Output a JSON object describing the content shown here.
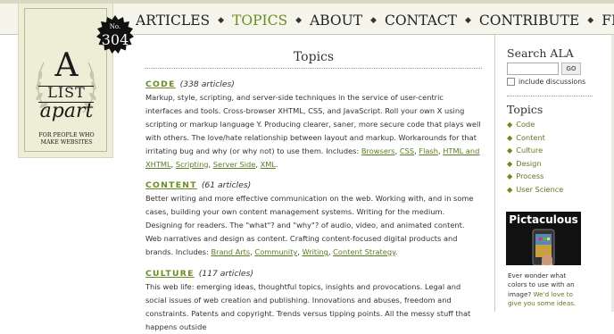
{
  "nav": {
    "items": [
      {
        "label": "ARTICLES",
        "active": false
      },
      {
        "label": "TOPICS",
        "active": true
      },
      {
        "label": "ABOUT",
        "active": false
      },
      {
        "label": "CONTACT",
        "active": false
      },
      {
        "label": "CONTRIBUTE",
        "active": false
      },
      {
        "label": "FEED",
        "active": false
      }
    ],
    "separator": "◆"
  },
  "logo": {
    "big_letter": "A",
    "list": "LIST",
    "apart": "apart",
    "tagline_1": "FOR PEOPLE WHO",
    "tagline_2": "MAKE WEBSITES"
  },
  "issue": {
    "no_label": "No.",
    "number": "304"
  },
  "main": {
    "title": "Topics",
    "sections": [
      {
        "name": "CODE",
        "count": "(338 articles)",
        "description": "Markup, style, scripting, and server-side techniques in the service of user-centric interfaces and tools. Cross-browser XHTML, CSS, and JavaScript. Roll your own X using scripting or markup language Y. Producing clearer, saner, more secure code that plays well with others. The love/hate relationship between layout and markup. Workarounds for that irritating bug and why (or why not) to use them. Includes:",
        "links": [
          "Browsers",
          "CSS",
          "Flash",
          "HTML and XHTML",
          "Scripting",
          "Server Side",
          "XML"
        ]
      },
      {
        "name": "CONTENT",
        "count": "(61 articles)",
        "description": "Better writing and more effective communication on the web. Working with, and in some cases, building your own content management systems. Writing for the medium. Designing for readers. The \"what\"? and \"why\"? of audio, video, and animated content. Web narratives and design as content. Crafting content-focused digital products and brands. Includes:",
        "links": [
          "Brand Arts",
          "Community",
          "Writing",
          "Content Strategy"
        ]
      },
      {
        "name": "CULTURE",
        "count": "(117 articles)",
        "description": "This web life: emerging ideas, thoughtful topics, insights and provocations. Legal and social issues of web creation and publishing. Innovations and abuses, freedom and constraints. Patents and copyright. Trends versus tipping points. All the messy stuff that happens outside",
        "links": []
      }
    ]
  },
  "sidebar": {
    "search_heading": "Search ALA",
    "search_value": "",
    "go_label": "GO",
    "include_discussions": "include discussions",
    "topics_heading": "Topics",
    "topics": [
      "Code",
      "Content",
      "Culture",
      "Design",
      "Process",
      "User Science"
    ],
    "bullet": "◆"
  },
  "ad": {
    "title": "Pictaculous",
    "text_1": "Ever wonder what colors to use with an image?",
    "text_2": "We'd love to give you some ideas."
  },
  "colors": {
    "accent": "#6a8c22",
    "link": "#5c7a1f",
    "logo_bg": "#eeeed6",
    "badge": "#111111"
  }
}
